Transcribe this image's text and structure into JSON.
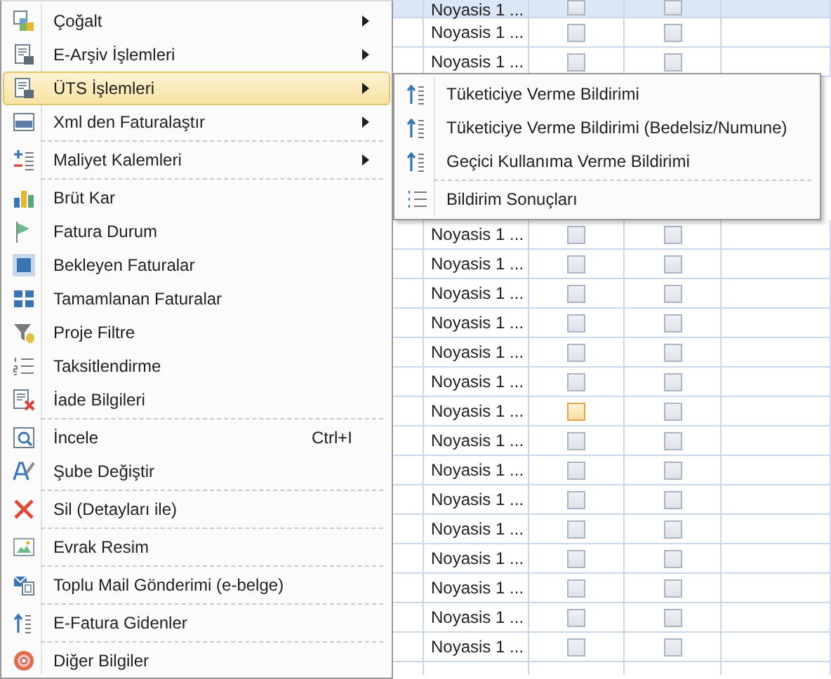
{
  "menu": {
    "items": [
      {
        "label": "Çoğalt",
        "has_submenu": true,
        "selected": false,
        "separator_before": false
      },
      {
        "label": "E-Arşiv İşlemleri",
        "has_submenu": true,
        "selected": false,
        "separator_before": false
      },
      {
        "label": "ÜTS İşlemleri",
        "has_submenu": true,
        "selected": true,
        "separator_before": false
      },
      {
        "label": "Xml den Faturalaştır",
        "has_submenu": true,
        "selected": false,
        "separator_before": false
      },
      {
        "label": "Maliyet Kalemleri",
        "has_submenu": true,
        "selected": false,
        "separator_before": true
      },
      {
        "label": "Brüt Kar",
        "has_submenu": false,
        "selected": false,
        "separator_before": true
      },
      {
        "label": "Fatura Durum",
        "has_submenu": false,
        "selected": false,
        "separator_before": false
      },
      {
        "label": "Bekleyen Faturalar",
        "has_submenu": false,
        "selected": false,
        "separator_before": false
      },
      {
        "label": "Tamamlanan Faturalar",
        "has_submenu": false,
        "selected": false,
        "separator_before": false
      },
      {
        "label": "Proje Filtre",
        "has_submenu": false,
        "selected": false,
        "separator_before": false
      },
      {
        "label": "Taksitlendirme",
        "has_submenu": false,
        "selected": false,
        "separator_before": false
      },
      {
        "label": "İade Bilgileri",
        "has_submenu": false,
        "selected": false,
        "separator_before": false
      },
      {
        "label": "İncele",
        "shortcut": "Ctrl+I",
        "has_submenu": false,
        "selected": false,
        "separator_before": true
      },
      {
        "label": "Şube Değiştir",
        "has_submenu": false,
        "selected": false,
        "separator_before": false
      },
      {
        "label": "Sil (Detayları ile)",
        "has_submenu": false,
        "selected": false,
        "separator_before": true
      },
      {
        "label": "Evrak Resim",
        "has_submenu": false,
        "selected": false,
        "separator_before": true
      },
      {
        "label": "Toplu Mail Gönderimi (e-belge)",
        "has_submenu": false,
        "selected": false,
        "separator_before": true
      },
      {
        "label": "E-Fatura Gidenler",
        "has_submenu": false,
        "selected": false,
        "separator_before": true
      },
      {
        "label": "Diğer Bilgiler",
        "has_submenu": false,
        "selected": false,
        "separator_before": true
      }
    ]
  },
  "submenu": {
    "items": [
      {
        "label": "Tüketiciye Verme Bildirimi",
        "has_submenu": false,
        "selected": false,
        "separator_before": false
      },
      {
        "label": "Tüketiciye Verme Bildirimi (Bedelsiz/Numune)",
        "has_submenu": false,
        "selected": false,
        "separator_before": false
      },
      {
        "label": "Geçici Kullanıma Verme Bildirimi",
        "has_submenu": false,
        "selected": false,
        "separator_before": false
      },
      {
        "label": "Bildirim Sonuçları",
        "has_submenu": false,
        "selected": false,
        "separator_before": true
      }
    ]
  },
  "grid": {
    "rows": [
      {
        "selected": true,
        "column_2": "Noyasis 1 ...",
        "column_3": {
          "checked": false,
          "hovered": false
        },
        "column_4": {
          "checked": false,
          "hovered": false
        }
      },
      {
        "selected": false,
        "column_2": "Noyasis 1 ...",
        "column_3": {
          "checked": false,
          "hovered": false
        },
        "column_4": {
          "checked": false,
          "hovered": false
        }
      },
      {
        "selected": false,
        "column_2": "Noyasis 1 ...",
        "column_3": {
          "checked": false,
          "hovered": false
        },
        "column_4": {
          "checked": false,
          "hovered": false
        }
      },
      {
        "selected": false,
        "column_2": "Noyasis 1 ...",
        "column_3": {
          "checked": false,
          "hovered": false
        },
        "column_4": {
          "checked": false,
          "hovered": false
        }
      },
      {
        "selected": false,
        "column_2": "Noyasis 1 ...",
        "column_3": {
          "checked": false,
          "hovered": false
        },
        "column_4": {
          "checked": false,
          "hovered": false
        }
      },
      {
        "selected": false,
        "column_2": "Noyasis 1 ...",
        "column_3": {
          "checked": false,
          "hovered": false
        },
        "column_4": {
          "checked": false,
          "hovered": false
        }
      },
      {
        "selected": false,
        "column_2": "Noyasis 1 ...",
        "column_3": {
          "checked": false,
          "hovered": false
        },
        "column_4": {
          "checked": false,
          "hovered": false
        }
      },
      {
        "selected": false,
        "column_2": "Noyasis 1 ...",
        "column_3": {
          "checked": false,
          "hovered": false
        },
        "column_4": {
          "checked": false,
          "hovered": false
        }
      },
      {
        "selected": false,
        "column_2": "Noyasis 1 ...",
        "column_3": {
          "checked": false,
          "hovered": false
        },
        "column_4": {
          "checked": false,
          "hovered": false
        }
      },
      {
        "selected": false,
        "column_2": "Noyasis 1 ...",
        "column_3": {
          "checked": false,
          "hovered": true
        },
        "column_4": {
          "checked": false,
          "hovered": false
        }
      },
      {
        "selected": false,
        "column_2": "Noyasis 1 ...",
        "column_3": {
          "checked": false,
          "hovered": false
        },
        "column_4": {
          "checked": false,
          "hovered": false
        }
      },
      {
        "selected": false,
        "column_2": "Noyasis 1 ...",
        "column_3": {
          "checked": false,
          "hovered": false
        },
        "column_4": {
          "checked": false,
          "hovered": false
        }
      },
      {
        "selected": false,
        "column_2": "Noyasis 1 ...",
        "column_3": {
          "checked": false,
          "hovered": false
        },
        "column_4": {
          "checked": false,
          "hovered": false
        }
      },
      {
        "selected": false,
        "column_2": "Noyasis 1 ...",
        "column_3": {
          "checked": false,
          "hovered": false
        },
        "column_4": {
          "checked": false,
          "hovered": false
        }
      },
      {
        "selected": false,
        "column_2": "Noyasis 1 ...",
        "column_3": {
          "checked": false,
          "hovered": false
        },
        "column_4": {
          "checked": false,
          "hovered": false
        }
      },
      {
        "selected": false,
        "column_2": "Noyasis 1 ...",
        "column_3": {
          "checked": false,
          "hovered": false
        },
        "column_4": {
          "checked": false,
          "hovered": false
        }
      },
      {
        "selected": false,
        "column_2": "Noyasis 1 ...",
        "column_3": {
          "checked": false,
          "hovered": false
        },
        "column_4": {
          "checked": false,
          "hovered": false
        }
      },
      {
        "selected": false,
        "column_2": "Noyasis 1 ...",
        "column_3": {
          "checked": false,
          "hovered": false
        },
        "column_4": {
          "checked": false,
          "hovered": false
        }
      }
    ]
  }
}
